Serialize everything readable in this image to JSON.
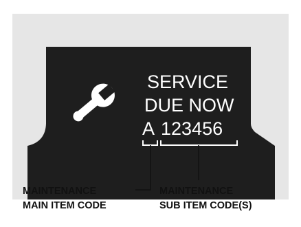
{
  "display": {
    "line1": "SERVICE",
    "line2": "DUE NOW",
    "main_code": "A",
    "sub_codes": "123456",
    "icon": "wrench-icon"
  },
  "callouts": {
    "main": {
      "line1": "MAINTENANCE",
      "line2": "MAIN ITEM CODE"
    },
    "sub": {
      "line1": "MAINTENANCE",
      "line2": "SUB ITEM CODE(S)"
    }
  },
  "colors": {
    "background_panel": "#e6e6e6",
    "display": "#1e1e1e",
    "display_text": "#ffffff",
    "label_text": "#111111"
  }
}
